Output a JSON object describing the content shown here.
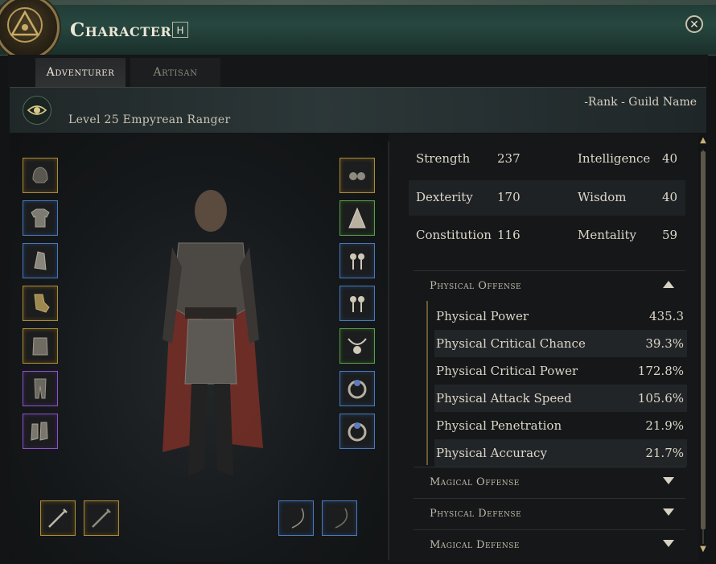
{
  "window": {
    "title": "Character",
    "hotkey": "H"
  },
  "tabs": [
    {
      "label": "Adventurer",
      "active": true
    },
    {
      "label": "Artisan",
      "active": false
    }
  ],
  "character": {
    "level_class": "Level 25  Empyrean Ranger",
    "guild": "-Rank - Guild Name"
  },
  "equipment": {
    "left": [
      {
        "name": "head-armor-icon",
        "rarity": "gold"
      },
      {
        "name": "chest-armor-icon",
        "rarity": "blue"
      },
      {
        "name": "cloak-icon",
        "rarity": "blue"
      },
      {
        "name": "gloves-icon",
        "rarity": "gold"
      },
      {
        "name": "belt-icon",
        "rarity": "gold"
      },
      {
        "name": "legs-armor-icon",
        "rarity": "purple"
      },
      {
        "name": "boots-icon",
        "rarity": "purple"
      }
    ],
    "right": [
      {
        "name": "earring-pair-icon",
        "rarity": "gold"
      },
      {
        "name": "cape-icon",
        "rarity": "green"
      },
      {
        "name": "earring-icon",
        "rarity": "blue"
      },
      {
        "name": "earring-icon",
        "rarity": "blue"
      },
      {
        "name": "necklace-icon",
        "rarity": "green"
      },
      {
        "name": "ring-icon",
        "rarity": "blue"
      },
      {
        "name": "ring-icon",
        "rarity": "blue"
      }
    ],
    "weapons": [
      {
        "name": "sword-icon",
        "rarity": "gold"
      },
      {
        "name": "sword-icon",
        "rarity": "gold"
      },
      {
        "name": "bow-icon",
        "rarity": "blue"
      },
      {
        "name": "bow-icon",
        "rarity": "blue"
      }
    ]
  },
  "attributes": [
    {
      "left_name": "Strength",
      "left_value": "237",
      "right_name": "Intelligence",
      "right_value": "40"
    },
    {
      "left_name": "Dexterity",
      "left_value": "170",
      "right_name": "Wisdom",
      "right_value": "40"
    },
    {
      "left_name": "Constitution",
      "left_value": "116",
      "right_name": "Mentality",
      "right_value": "59"
    }
  ],
  "sections": {
    "physical_offense": {
      "label": "Physical Offense",
      "expanded": true,
      "stats": [
        {
          "name": "Physical Power",
          "value": "435.3"
        },
        {
          "name": "Physical Critical Chance",
          "value": "39.3%"
        },
        {
          "name": "Physical Critical Power",
          "value": "172.8%"
        },
        {
          "name": "Physical Attack Speed",
          "value": "105.6%"
        },
        {
          "name": "Physical Penetration",
          "value": "21.9%"
        },
        {
          "name": "Physical Accuracy",
          "value": "21.7%"
        }
      ]
    },
    "magical_offense": {
      "label": "Magical Offense",
      "expanded": false
    },
    "physical_defense": {
      "label": "Physical Defense",
      "expanded": false
    },
    "magical_defense": {
      "label": "Magical Defense",
      "expanded": false
    }
  },
  "colors": {
    "gold": "#a98b3e",
    "blue": "#4c79b6",
    "purple": "#8b55c3",
    "green": "#5d9b4e",
    "header": "#26473f"
  }
}
